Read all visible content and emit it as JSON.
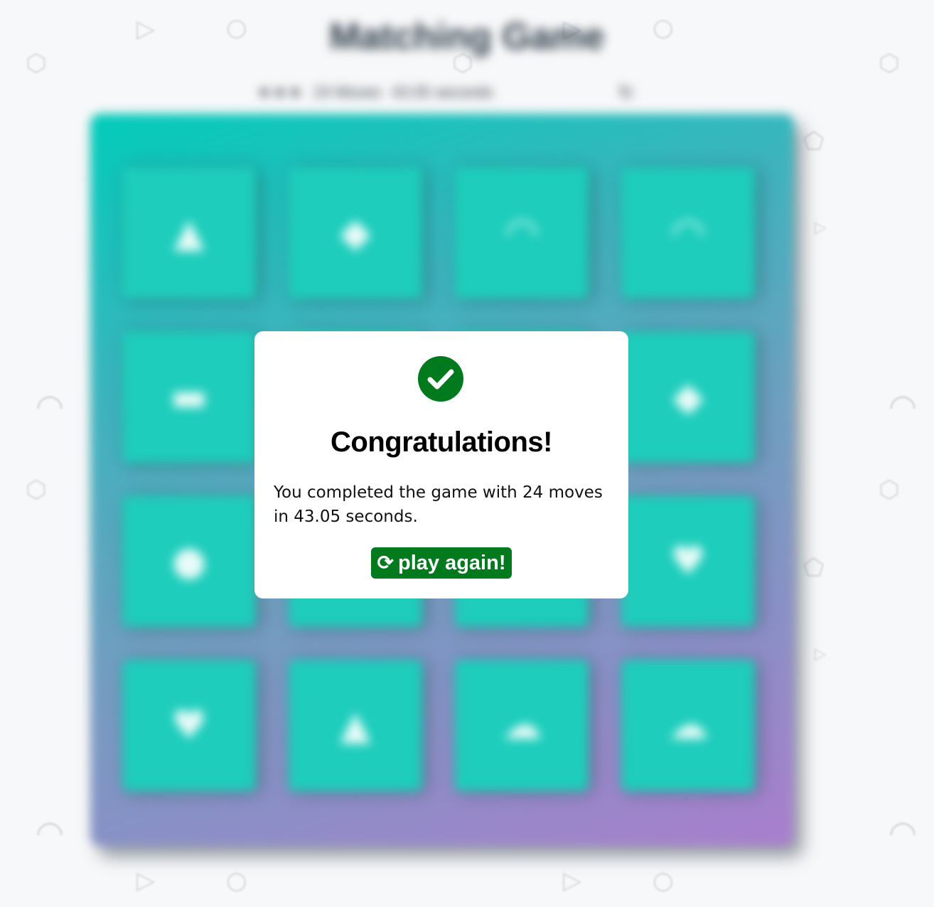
{
  "header": {
    "title": "Matching Game",
    "stars": "★★★",
    "moves_text": "24 Moves",
    "timer_text": "43.05 seconds",
    "restart_icon": "↻"
  },
  "deck": {
    "cards": [
      {
        "icon": "triangle",
        "glyph": "▲"
      },
      {
        "icon": "diamond",
        "glyph": "◆"
      },
      {
        "icon": "half-circle",
        "glyph": "◠"
      },
      {
        "icon": "half-circle",
        "glyph": "◠"
      },
      {
        "icon": "rectangle",
        "glyph": "▬"
      },
      {
        "icon": "hidden",
        "glyph": ""
      },
      {
        "icon": "hidden",
        "glyph": ""
      },
      {
        "icon": "diamond",
        "glyph": "◆"
      },
      {
        "icon": "dot",
        "glyph": "●"
      },
      {
        "icon": "hidden",
        "glyph": ""
      },
      {
        "icon": "hidden",
        "glyph": ""
      },
      {
        "icon": "heart",
        "glyph": "♥"
      },
      {
        "icon": "heart",
        "glyph": "♥"
      },
      {
        "icon": "mountain",
        "glyph": "▲"
      },
      {
        "icon": "cloud",
        "glyph": "☁"
      },
      {
        "icon": "cloud",
        "glyph": "☁"
      }
    ]
  },
  "modal": {
    "icon": "check-circle-icon",
    "title": "Congratulations!",
    "message": "You completed the game with 24 moves in 43.05 seconds.",
    "button_icon": "⟳",
    "button_label": "play again!"
  },
  "colors": {
    "success_green": "#007a1c",
    "card_teal": "#1ecdbc",
    "deck_gradient_start": "#02ccba",
    "deck_gradient_end": "#aa7ecd"
  }
}
